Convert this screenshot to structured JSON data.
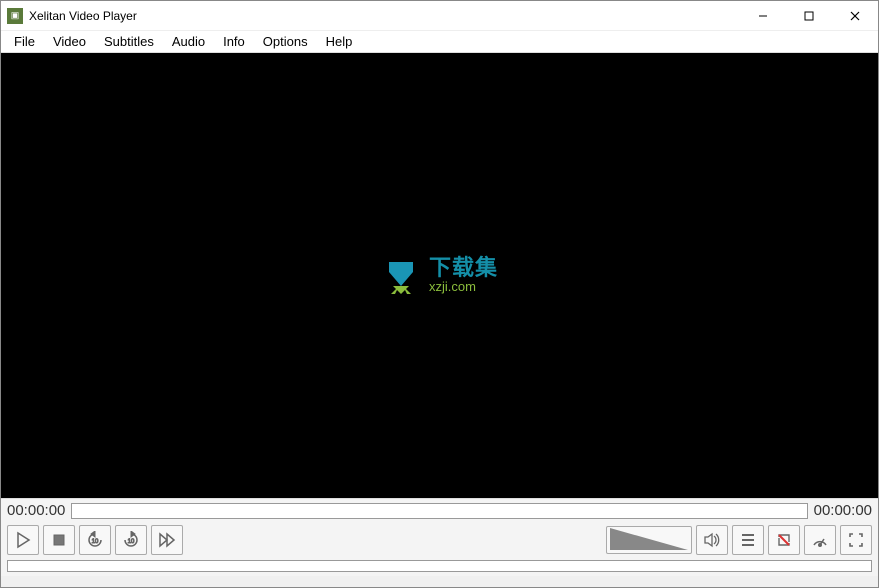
{
  "window": {
    "title": "Xelitan Video Player"
  },
  "menu": {
    "items": [
      "File",
      "Video",
      "Subtitles",
      "Audio",
      "Info",
      "Options",
      "Help"
    ]
  },
  "watermark": {
    "text_main": "下载集",
    "text_sub": "xzji.com"
  },
  "time": {
    "current": "00:00:00",
    "total": "00:00:00"
  },
  "controls": {
    "play": "play",
    "stop": "stop",
    "back10": "back10",
    "fwd10": "fwd10",
    "fastforward": "ff",
    "speaker": "speaker",
    "playlist": "playlist",
    "repeat_off": "repeat_off",
    "speed": "speed",
    "fullscreen": "fullscreen"
  }
}
